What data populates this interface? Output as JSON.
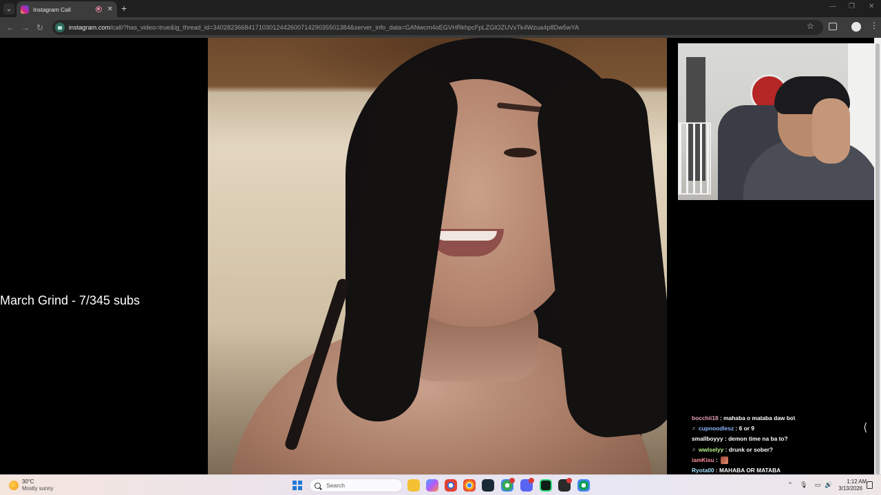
{
  "browser": {
    "tab_title": "Instagram Call",
    "close_tab_glyph": "✕",
    "new_tab_glyph": "+",
    "url_host": "instagram.com",
    "url_path": "/call/?has_video=true&ig_thread_id=340282366841710301244260071429035501384&server_info_data=GANwcm4oEGVHRkhpcFpLZGlOZUVxTk4Wzua4p8Dw5wYA",
    "icons": [
      "tab-search-icon",
      "instagram-favicon",
      "recording-icon",
      "close-icon",
      "plus-icon",
      "back-icon",
      "forward-icon",
      "reload-icon",
      "site-info-icon",
      "star-icon",
      "extensions-icon",
      "profile-icon",
      "menu-icon"
    ]
  },
  "overlay": {
    "grind_text": "March Grind - 7/345 subs"
  },
  "chat": {
    "toggle_glyph": "⟨",
    "messages": [
      {
        "user": "bocchii18",
        "user_color": "#e7a0b8",
        "badge": "",
        "text": " : mahaba o mataba daw bo\\"
      },
      {
        "user": "cupnoodlesz",
        "user_color": "#8fb8ff",
        "badge": "♬",
        "text": " : 6 or 9"
      },
      {
        "user": "smallboyyy",
        "user_color": "#ffffff",
        "badge": "",
        "text": " : demon time na ba to?"
      },
      {
        "user": "wwlselyy",
        "user_color": "#b8f58a",
        "badge": "♬",
        "text": " : drunk or sober?"
      },
      {
        "user": "iamKisu",
        "user_color": "#ff8fa0",
        "badge": "",
        "text": " : ",
        "emote": true
      },
      {
        "user": "Ryota00",
        "user_color": "#a6e3ff",
        "badge": "",
        "text": " : MAHABA OR MATABA"
      }
    ]
  },
  "taskbar": {
    "weather_temp": "30°C",
    "weather_desc": "Mostly sunny",
    "search_label": "Search",
    "clock_time": "1:12 AM",
    "clock_date": "3/13/2026",
    "accent": "#1e78d6"
  }
}
